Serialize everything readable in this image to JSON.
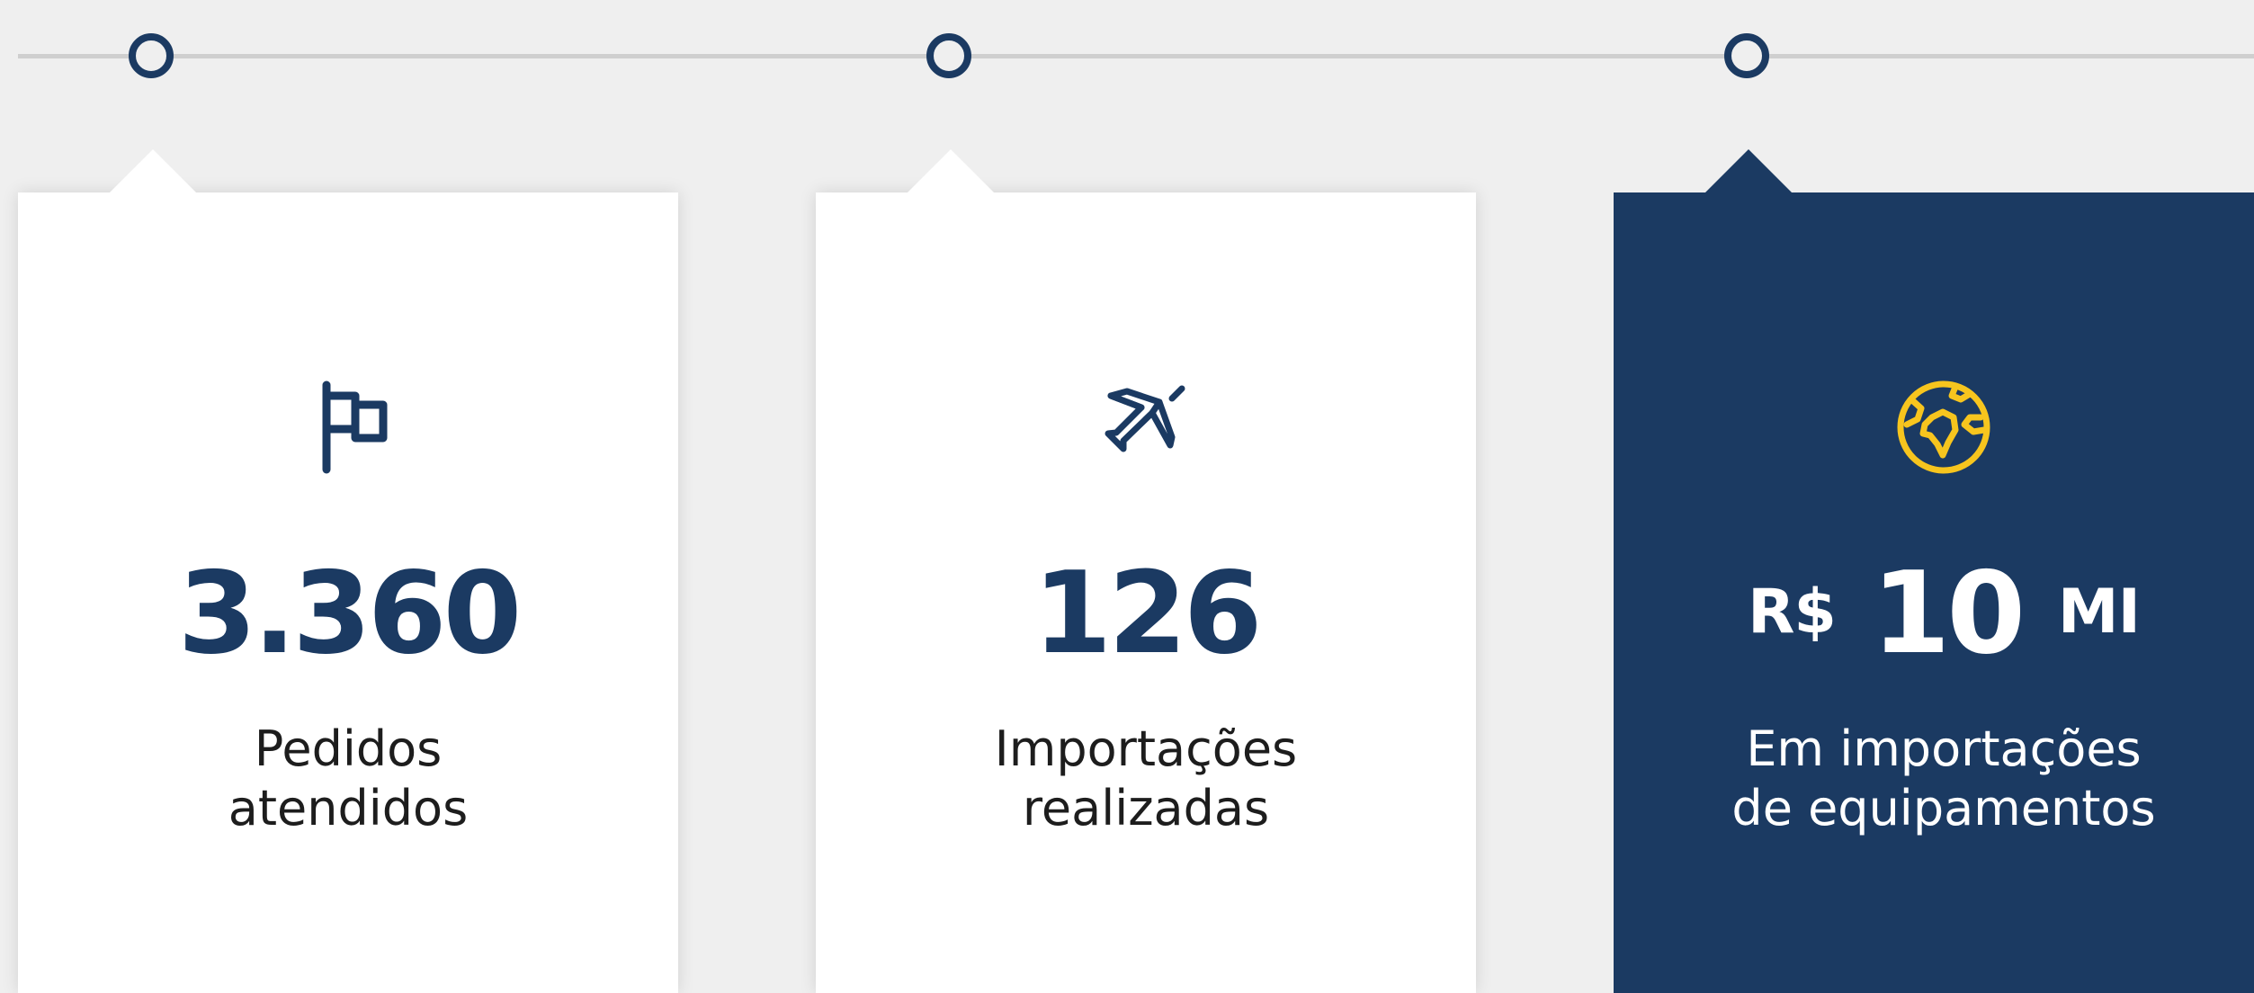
{
  "colors": {
    "background": "#efefef",
    "timeline": "#cfcfcf",
    "navy": "#1b3a62",
    "accent_yellow": "#f7c51e",
    "card_white": "#ffffff",
    "text_dark": "#1d1d1d"
  },
  "timeline": {
    "dots": [
      {
        "name": "timeline-dot-1",
        "active": false
      },
      {
        "name": "timeline-dot-2",
        "active": false
      },
      {
        "name": "timeline-dot-3",
        "active": true
      }
    ]
  },
  "stats": [
    {
      "icon": "flag-icon",
      "value": "3.360",
      "label_line1": "Pedidos",
      "label_line2": "atendidos",
      "active": false
    },
    {
      "icon": "airplane-icon",
      "value": "126",
      "label_line1": "Importações",
      "label_line2": "realizadas",
      "active": false
    },
    {
      "icon": "globe-icon",
      "value_prefix": "R$",
      "value": "10",
      "value_suffix": "MI",
      "label_line1": "Em importações",
      "label_line2": "de equipamentos",
      "active": true
    }
  ]
}
